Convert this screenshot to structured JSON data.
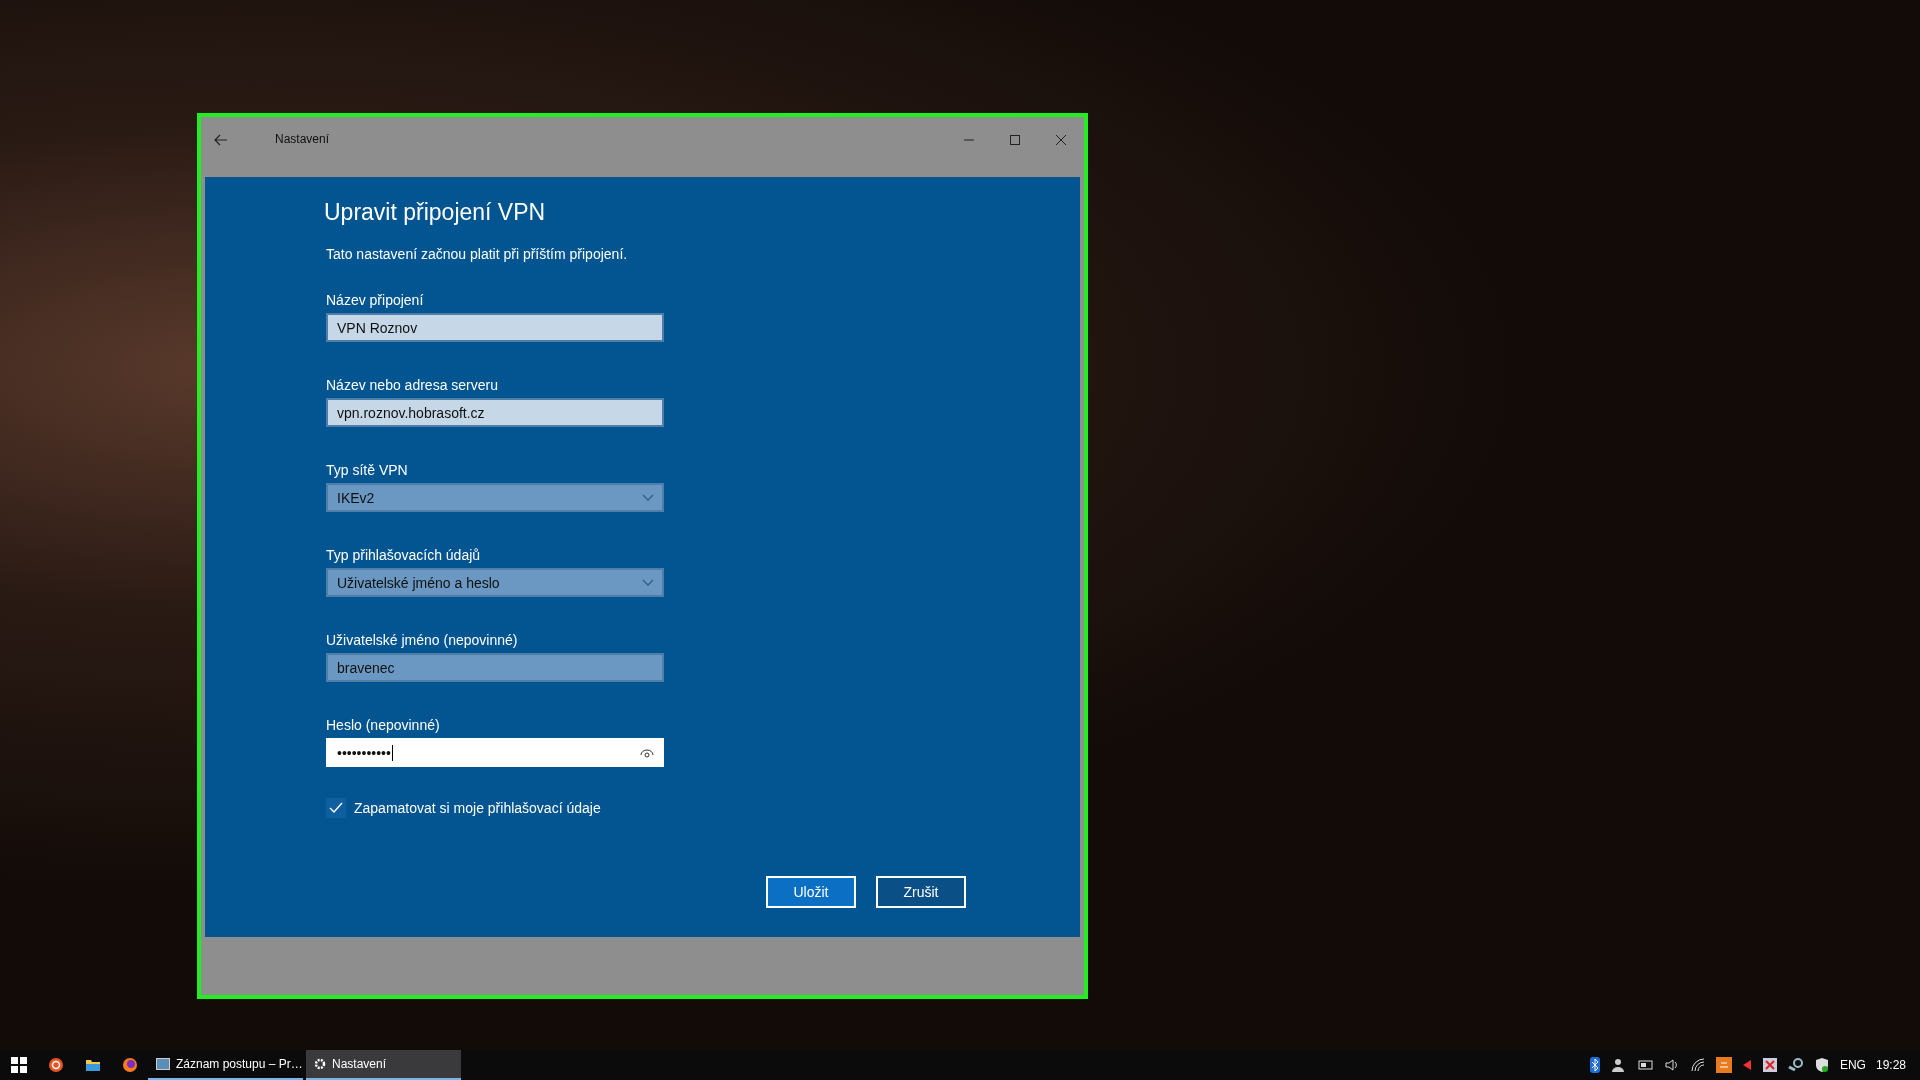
{
  "window": {
    "title": "Nastavení"
  },
  "page": {
    "heading": "Upravit připojení VPN",
    "description": "Tato nastavení začnou platit při příštím připojení."
  },
  "fields": [
    {
      "kind": "text",
      "label": "Název připojení",
      "value": "VPN Roznov",
      "disabled": false
    },
    {
      "kind": "text",
      "label": "Název nebo adresa serveru",
      "value": "vpn.roznov.hobrasoft.cz",
      "disabled": false
    },
    {
      "kind": "select",
      "label": "Typ sítě VPN",
      "value": "IKEv2",
      "disabled": true
    },
    {
      "kind": "select",
      "label": "Typ přihlašovacích údajů",
      "value": "Uživatelské jméno a heslo",
      "disabled": true
    },
    {
      "kind": "text",
      "label": "Uživatelské jméno (nepovinné)",
      "value": "bravenec",
      "disabled": true
    },
    {
      "kind": "password",
      "label": "Heslo (nepovinné)",
      "value": "•••••••••••",
      "disabled": false
    }
  ],
  "remember": {
    "label": "Zapamatovat si moje přihlašovací údaje",
    "checked": true
  },
  "buttons": [
    {
      "label": "Uložit",
      "primary": true
    },
    {
      "label": "Zrušit",
      "primary": false
    }
  ],
  "taskbar": {
    "apps": [
      {
        "label": "Záznam postupu – Pr…",
        "selected": false
      },
      {
        "label": "Nastavení",
        "selected": true
      }
    ],
    "language": "ENG",
    "time": "19:28"
  }
}
